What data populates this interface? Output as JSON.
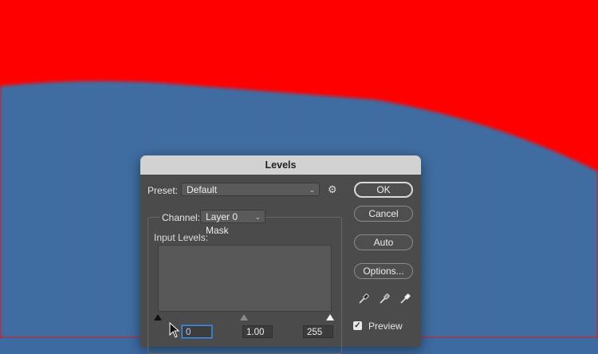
{
  "dialog": {
    "title": "Levels",
    "preset": {
      "label": "Preset:",
      "value": "Default"
    },
    "channel": {
      "label": "Channel:",
      "value": "Layer 0 Mask"
    },
    "input_levels": {
      "label": "Input Levels:",
      "black": "0",
      "midtone": "1.00",
      "white": "255"
    },
    "buttons": {
      "ok": "OK",
      "cancel": "Cancel",
      "auto": "Auto",
      "options": "Options..."
    },
    "preview": {
      "label": "Preview",
      "checked": true
    }
  },
  "colors": {
    "background_red": "#ff0000",
    "fabric_blue": "#3d6aa0",
    "dialog_bg": "#4b4b4b",
    "titlebar": "#d2d2d2"
  },
  "icons": [
    "gear-icon",
    "black-eyedropper-icon",
    "gray-eyedropper-icon",
    "white-eyedropper-icon",
    "mouse-pointer-icon"
  ]
}
